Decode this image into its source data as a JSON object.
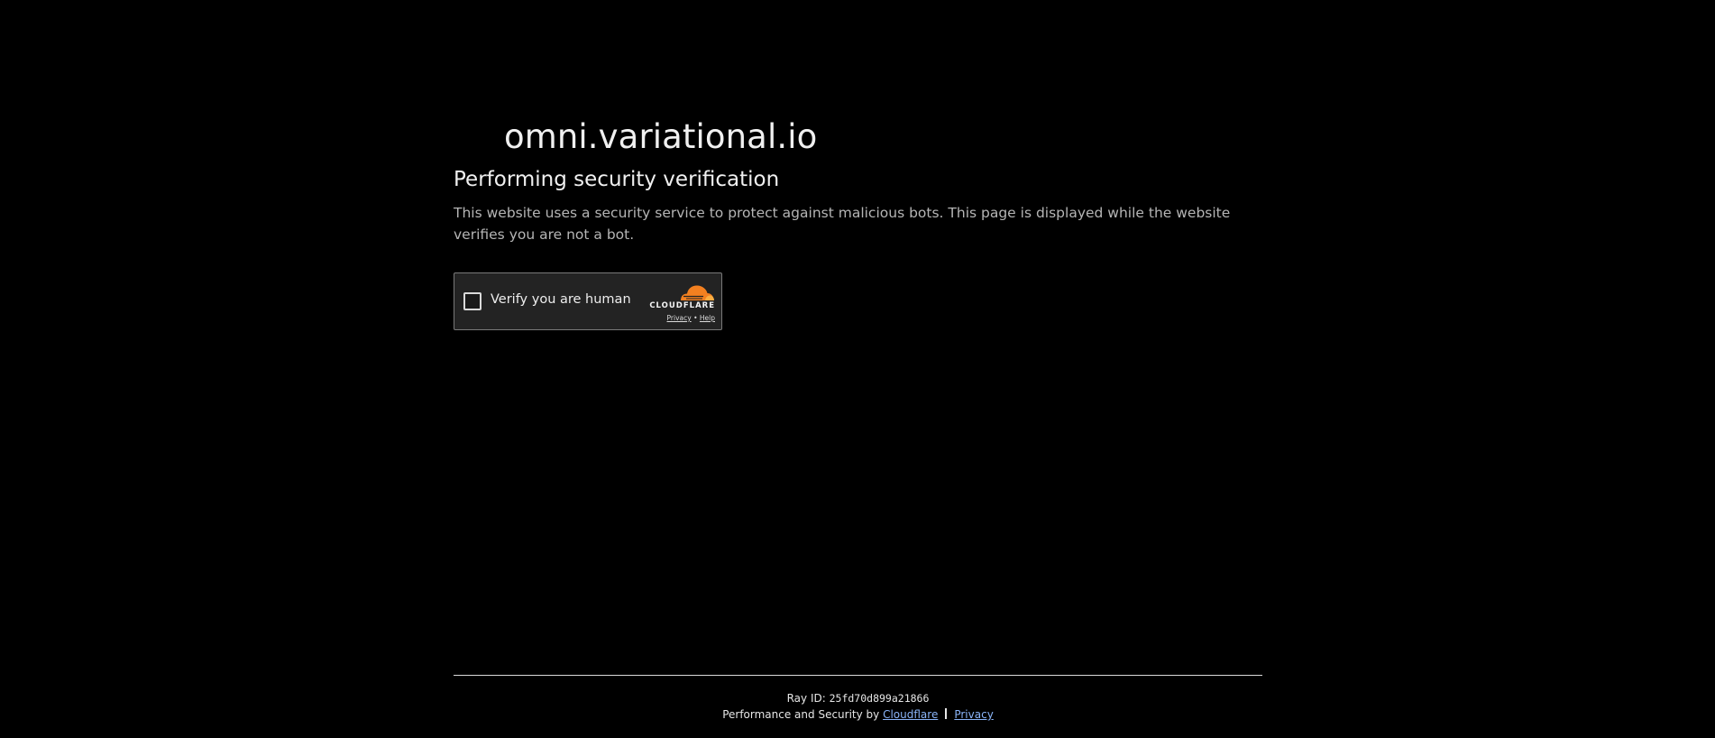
{
  "site": {
    "domain": "omni.variational.io"
  },
  "verification": {
    "heading": "Performing security verification",
    "description": "This website uses a security service to protect against malicious bots. This page is displayed while the website verifies you are not a bot."
  },
  "widget": {
    "checkbox_label": "Verify you are human",
    "checked": false,
    "brand_name": "CLOUDFLARE",
    "brand_icon": "cloudflare-cloud-icon",
    "privacy_link": "Privacy",
    "separator": "•",
    "help_link": "Help",
    "brand_color": "#f38020"
  },
  "footer": {
    "ray_label": "Ray ID:",
    "ray_id": "25fd70d899a21866",
    "perf_prefix": "Performance and Security by",
    "cloudflare_link": "Cloudflare",
    "privacy_link": "Privacy"
  }
}
